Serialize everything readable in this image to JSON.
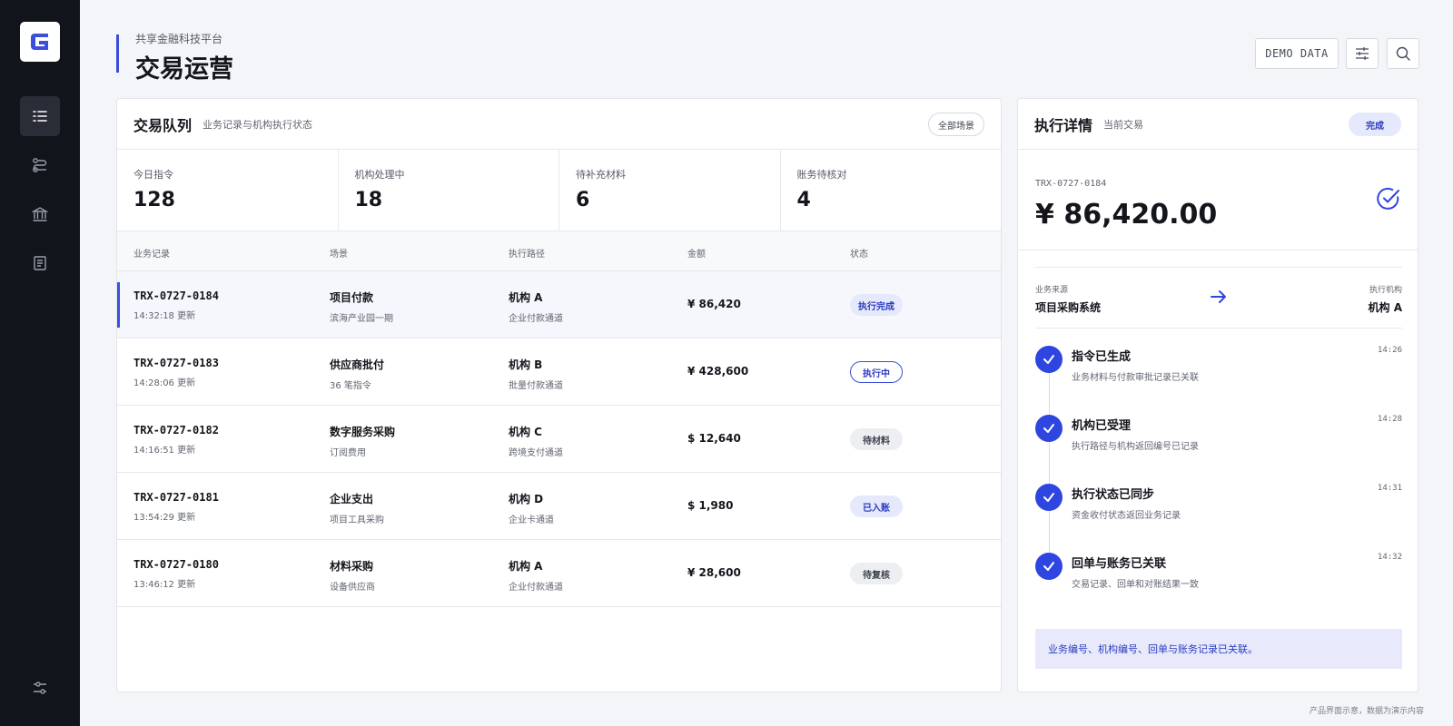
{
  "header": {
    "subtitle": "共享金融科技平台",
    "title": "交易运营",
    "demo_label": "DEMO DATA"
  },
  "sidebar": {
    "items": [
      {
        "icon": "list-icon",
        "active": true
      },
      {
        "icon": "flow-icon",
        "active": false
      },
      {
        "icon": "bank-icon",
        "active": false
      },
      {
        "icon": "document-icon",
        "active": false
      }
    ],
    "bottom_icon": "settings-sliders-icon"
  },
  "queue": {
    "title": "交易队列",
    "subtitle": "业务记录与机构执行状态",
    "filter_label": "全部场景",
    "stats": [
      {
        "label": "今日指令",
        "value": "128"
      },
      {
        "label": "机构处理中",
        "value": "18"
      },
      {
        "label": "待补充材料",
        "value": "6"
      },
      {
        "label": "账务待核对",
        "value": "4"
      }
    ],
    "columns": [
      "业务记录",
      "场景",
      "执行路径",
      "金额",
      "状态"
    ],
    "rows": [
      {
        "id": "TRX-0727-0184",
        "updated": "14:32:18 更新",
        "scene": "项目付款",
        "scene_sub": "滨海产业园一期",
        "route": "机构 A",
        "route_sub": "企业付款通道",
        "amount": "¥ 86,420",
        "status": "执行完成",
        "status_style": "blue",
        "selected": true
      },
      {
        "id": "TRX-0727-0183",
        "updated": "14:28:06 更新",
        "scene": "供应商批付",
        "scene_sub": "36 笔指令",
        "route": "机构 B",
        "route_sub": "批量付款通道",
        "amount": "¥ 428,600",
        "status": "执行中",
        "status_style": "outline",
        "selected": false
      },
      {
        "id": "TRX-0727-0182",
        "updated": "14:16:51 更新",
        "scene": "数字服务采购",
        "scene_sub": "订阅费用",
        "route": "机构 C",
        "route_sub": "跨境支付通道",
        "amount": "$ 12,640",
        "status": "待材料",
        "status_style": "gray",
        "selected": false
      },
      {
        "id": "TRX-0727-0181",
        "updated": "13:54:29 更新",
        "scene": "企业支出",
        "scene_sub": "项目工具采购",
        "route": "机构 D",
        "route_sub": "企业卡通道",
        "amount": "$ 1,980",
        "status": "已入账",
        "status_style": "blue",
        "selected": false
      },
      {
        "id": "TRX-0727-0180",
        "updated": "13:46:12 更新",
        "scene": "材料采购",
        "scene_sub": "设备供应商",
        "route": "机构 A",
        "route_sub": "企业付款通道",
        "amount": "¥ 28,600",
        "status": "待复核",
        "status_style": "gray",
        "selected": false
      }
    ]
  },
  "detail": {
    "title": "执行详情",
    "subtitle": "当前交易",
    "status": "完成",
    "transaction_id": "TRX-0727-0184",
    "amount": "¥ 86,420.00",
    "source_label": "业务来源",
    "source_value": "项目采购系统",
    "executor_label": "执行机构",
    "executor_value": "机构 A",
    "steps": [
      {
        "title": "指令已生成",
        "desc": "业务材料与付款审批记录已关联",
        "time": "14:26"
      },
      {
        "title": "机构已受理",
        "desc": "执行路径与机构返回编号已记录",
        "time": "14:28"
      },
      {
        "title": "执行状态已同步",
        "desc": "资金收付状态返回业务记录",
        "time": "14:31"
      },
      {
        "title": "回单与账务已关联",
        "desc": "交易记录、回单和对账结果一致",
        "time": "14:32"
      }
    ],
    "note": "业务编号、机构编号、回单与账务记录已关联。"
  },
  "footer": "产品界面示意，数据为演示内容",
  "colors": {
    "accent": "#2f45e0",
    "sidebar": "#12141b",
    "background": "#f4f5f8"
  }
}
